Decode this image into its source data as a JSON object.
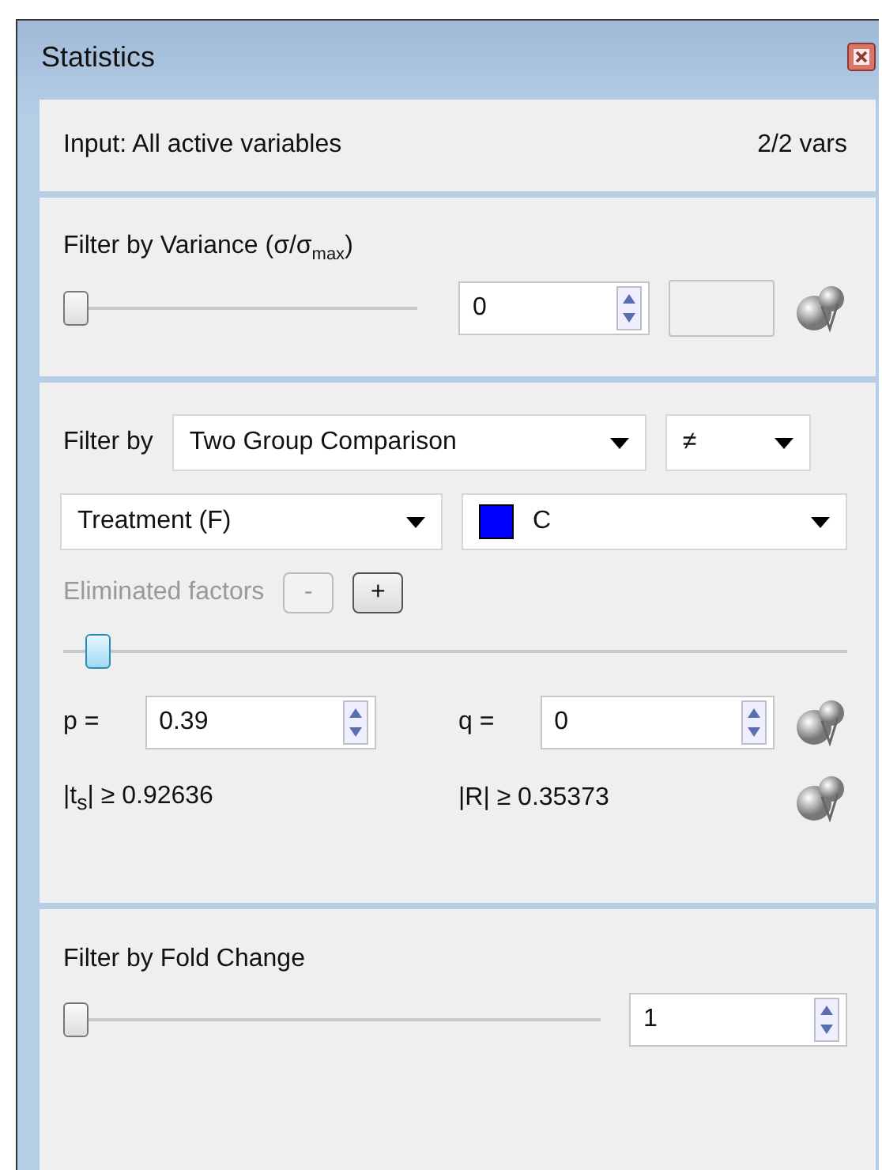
{
  "window": {
    "title": "Statistics"
  },
  "input": {
    "label": "Input: All active variables",
    "count": "2/2 vars"
  },
  "variance": {
    "title": "Filter by Variance (σ/σ$_{max}$)",
    "slider": {
      "level": 0
    },
    "value": "0"
  },
  "test": {
    "label": "Filter by",
    "method": "Two Group Comparison",
    "operator": "≠",
    "factor": "Treatment (F)",
    "group": {
      "label": "C",
      "color": "#0000ff"
    },
    "eliminated": {
      "label": "Eliminated factors",
      "disabled": true,
      "buttons": [
        {
          "label": "-",
          "disabled": true
        },
        {
          "label": "+",
          "disabled": false
        }
      ]
    },
    "slider": {
      "level": 0.03
    },
    "p": {
      "label": "p =",
      "value": "0.39"
    },
    "q": {
      "label": "q =",
      "value": "0"
    },
    "t_stat": "|t$_{s}$| ≥ 0.92636",
    "r_stat": "|R| ≥ 0.35373"
  },
  "fold": {
    "title": "Filter by Fold Change",
    "slider": {
      "level": 0
    },
    "value": "1"
  }
}
